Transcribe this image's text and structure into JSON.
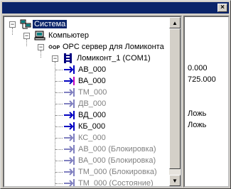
{
  "titlebar": {
    "close_label": "×"
  },
  "tree": {
    "root": {
      "label": "Система",
      "expander": "−"
    },
    "computer": {
      "label": "Компьютер",
      "expander": "−"
    },
    "opc": {
      "label": "OPC сервер для Ломиконта",
      "expander": "−"
    },
    "lomikont": {
      "label": "Ломиконт_1 (COM1)",
      "expander": "−"
    },
    "items": [
      {
        "label": "АВ_000",
        "enabled": true,
        "value": "0.000"
      },
      {
        "label": "ВА_000",
        "enabled": true,
        "value": "725.000"
      },
      {
        "label": "ТМ_000",
        "enabled": false,
        "value": ""
      },
      {
        "label": "ДВ_000",
        "enabled": false,
        "value": ""
      },
      {
        "label": "ВД_000",
        "enabled": true,
        "value": "Ложь"
      },
      {
        "label": "КБ_000",
        "enabled": true,
        "value": "Ложь"
      },
      {
        "label": "КС_000",
        "enabled": false,
        "value": ""
      },
      {
        "label": "АВ_000 (Блокировка)",
        "enabled": false,
        "value": ""
      },
      {
        "label": "ВА_000 (Блокировка)",
        "enabled": false,
        "value": ""
      },
      {
        "label": "ТМ_000 (Блокировка)",
        "enabled": false,
        "value": ""
      },
      {
        "label": "ТМ_000 (Состояние)",
        "enabled": false,
        "value": ""
      }
    ]
  },
  "scrollbar": {
    "up_arrow": "▲",
    "down_arrow": "▼"
  },
  "icons": {
    "root": "network-computer-icon",
    "computer": "computer-icon",
    "opc": "opc-server-icon",
    "lomikont": "controller-icon",
    "item": "tag-arrow-icon"
  },
  "colors": {
    "selection": "#0a246a",
    "titlebar": "#0a246a",
    "disabled_text": "#808080",
    "tag_icon": "#0000c0",
    "write_marker": "#c000c0"
  }
}
